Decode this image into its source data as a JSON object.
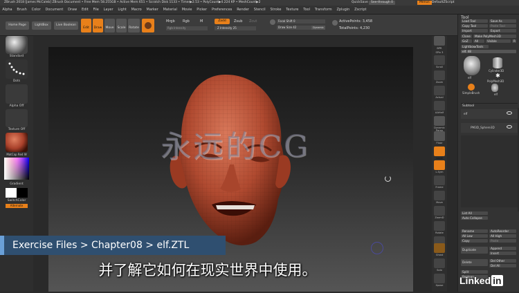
{
  "titlebar": {
    "text": "ZBrush 2018 [James McCaleb]   ZBrush Document   • Free Mem 58.255GB • Active Mem 651 • Scratch Disk 1133 • Timer▶2.53 • PolyCount▶4.224 KP • MeshCount▶2",
    "quicksave": "QuickSave",
    "seethrough": "See-through  0",
    "menus": "Menus",
    "script": "DefaultZScript"
  },
  "menubar": [
    "Alpha",
    "Brush",
    "Color",
    "Document",
    "Draw",
    "Edit",
    "File",
    "Layer",
    "Light",
    "Macro",
    "Marker",
    "Material",
    "Movie",
    "Picker",
    "Preferences",
    "Render",
    "Stencil",
    "Stroke",
    "Texture",
    "Tool",
    "Transform",
    "Zplugin",
    "Zscript"
  ],
  "toolbar": {
    "home": "Home Page",
    "lightbox": "LightBox",
    "liveboolean": "Live Boolean",
    "edit": "Edit",
    "draw": "Draw",
    "move": "Move",
    "scale": "Scale",
    "rotate": "Rotate",
    "mrgb": "Mrgb",
    "rgb": "Rgb",
    "m": "M",
    "rgbintensity": "Rgb Intensity",
    "zadd": "Zadd",
    "zsub": "Zsub",
    "zcut": "Zcut",
    "zintensity": "Z Intensity 25",
    "focalshift": "Focal Shift 0",
    "drawsize": "Draw Size 42",
    "dynamic": "Dynamic",
    "activepoints": "ActivePoints: 3,458",
    "totalpoints": "TotalPoints: 4,230"
  },
  "leftshelf": {
    "standard": "Standard",
    "dots": "Dots",
    "alphaoff": "Alpha Off",
    "textureoff": "Texture Off",
    "matcap": "MatCap Red W",
    "gradient": "Gradient",
    "switchcolor": "SwitchColor",
    "alternate": "Alternate"
  },
  "rightshelf": [
    "BPR",
    "SPix 3",
    "Scroll",
    "Zoom",
    "Actual",
    "AAHalf",
    "Dynamic Persp",
    "Floor",
    "Local",
    "L.Sym",
    "Frame",
    "Move",
    "ZoomD",
    "Rotate",
    "Transp",
    "Ghost",
    "Solo",
    "Xpose"
  ],
  "tray": {
    "title": "Tool",
    "loadtool": "Load Tool",
    "saveas": "Save As",
    "copytool": "Copy Tool",
    "pastetool": "Paste Tool",
    "import": "Import",
    "export": "Export",
    "clone": "Clone",
    "makepolymesh": "Make PolyMesh3D",
    "goz": "GoZ",
    "all": "All",
    "visible": "Visible",
    "r": "R",
    "lightboxtools": "Lightbox▸Tools",
    "elfnum": "elf. 48",
    "toolnames": [
      "elf",
      "Cylinder3D",
      "PolyMesh3D",
      "SimpleBrush",
      "elf"
    ],
    "subtool": "Subtool",
    "subitems": [
      "elf",
      "PM3D_Sphere3D"
    ],
    "listall": "List All",
    "autocollapse": "Auto Collapse",
    "rename": "Rename",
    "autoreorder": "AutoReorder",
    "alllow": "All Low",
    "allhigh": "All High",
    "copy": "Copy",
    "paste": "Paste",
    "duplicate": "Duplicate",
    "append": "Append",
    "insert": "Insert",
    "delete": "Delete",
    "delother": "Del Other",
    "delall": "Del All",
    "split": "Split",
    "boolean": "Boolean"
  },
  "breadcrumb": "Exercise Files > Chapter08 > elf.ZTL",
  "subtitle": "并了解它如何在现实世界中使用。",
  "watermark": "永远的CG",
  "linkedin": {
    "a": "Linked",
    "b": "in"
  },
  "colors": {
    "accent": "#e8801a",
    "skin": "#b8553a",
    "banner": "#2f4f70"
  }
}
